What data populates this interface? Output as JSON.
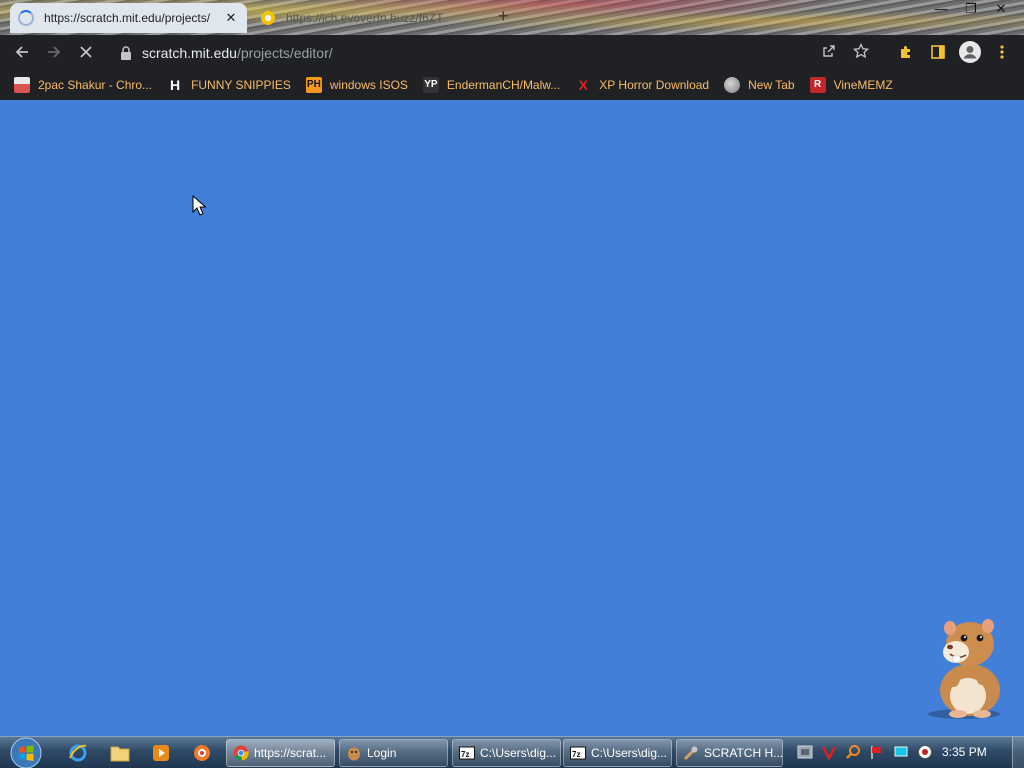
{
  "browser": {
    "tabs": [
      {
        "title": "https://scratch.mit.edu/projects/",
        "state": "loading",
        "close_label": "✕"
      },
      {
        "title": "https://jch.evovertn.buzz/f6ZT"
      }
    ],
    "new_tab_label": "+",
    "window_controls": {
      "minimize": "—",
      "maximize": "❐",
      "close": "✕"
    },
    "toolbar": {
      "url_host": "scratch.mit.edu",
      "url_path": "/projects/editor/"
    },
    "bookmarks": [
      {
        "label": "2pac Shakur - Chro...",
        "icon": "bag-icon",
        "icon_text": "",
        "color": "#d9534f"
      },
      {
        "label": "FUNNY SNIPPIES",
        "icon": "h-logo-icon",
        "icon_text": "H",
        "color": "#ffffff"
      },
      {
        "label": "windows ISOS",
        "icon": "ph-logo-icon",
        "icon_text": "PH",
        "color": "#f7971d"
      },
      {
        "label": "EndermanCH/Malw...",
        "icon": "yp-logo-icon",
        "icon_text": "YP",
        "color": "#333333"
      },
      {
        "label": "XP Horror Download",
        "icon": "x-logo-icon",
        "icon_text": "X",
        "color": "#e02020"
      },
      {
        "label": "New Tab",
        "icon": "globe-icon",
        "icon_text": "",
        "color": "#aaaaaa"
      },
      {
        "label": "VineMEMZ",
        "icon": "r-logo-icon",
        "icon_text": "R",
        "color": "#c0272d"
      }
    ]
  },
  "page": {
    "background": "#427fd9"
  },
  "taskbar": {
    "tasks": [
      {
        "label": "https://scrat...",
        "icon": "chrome-icon",
        "active": true
      },
      {
        "label": "Login",
        "icon": "hamster-app-icon"
      },
      {
        "label": "C:\\Users\\dig...",
        "icon": "7zip-icon"
      },
      {
        "label": "C:\\Users\\dig...",
        "icon": "7zip-icon"
      },
      {
        "label": "SCRATCH H...",
        "icon": "tool-icon"
      }
    ],
    "clock": "3:35 PM"
  }
}
